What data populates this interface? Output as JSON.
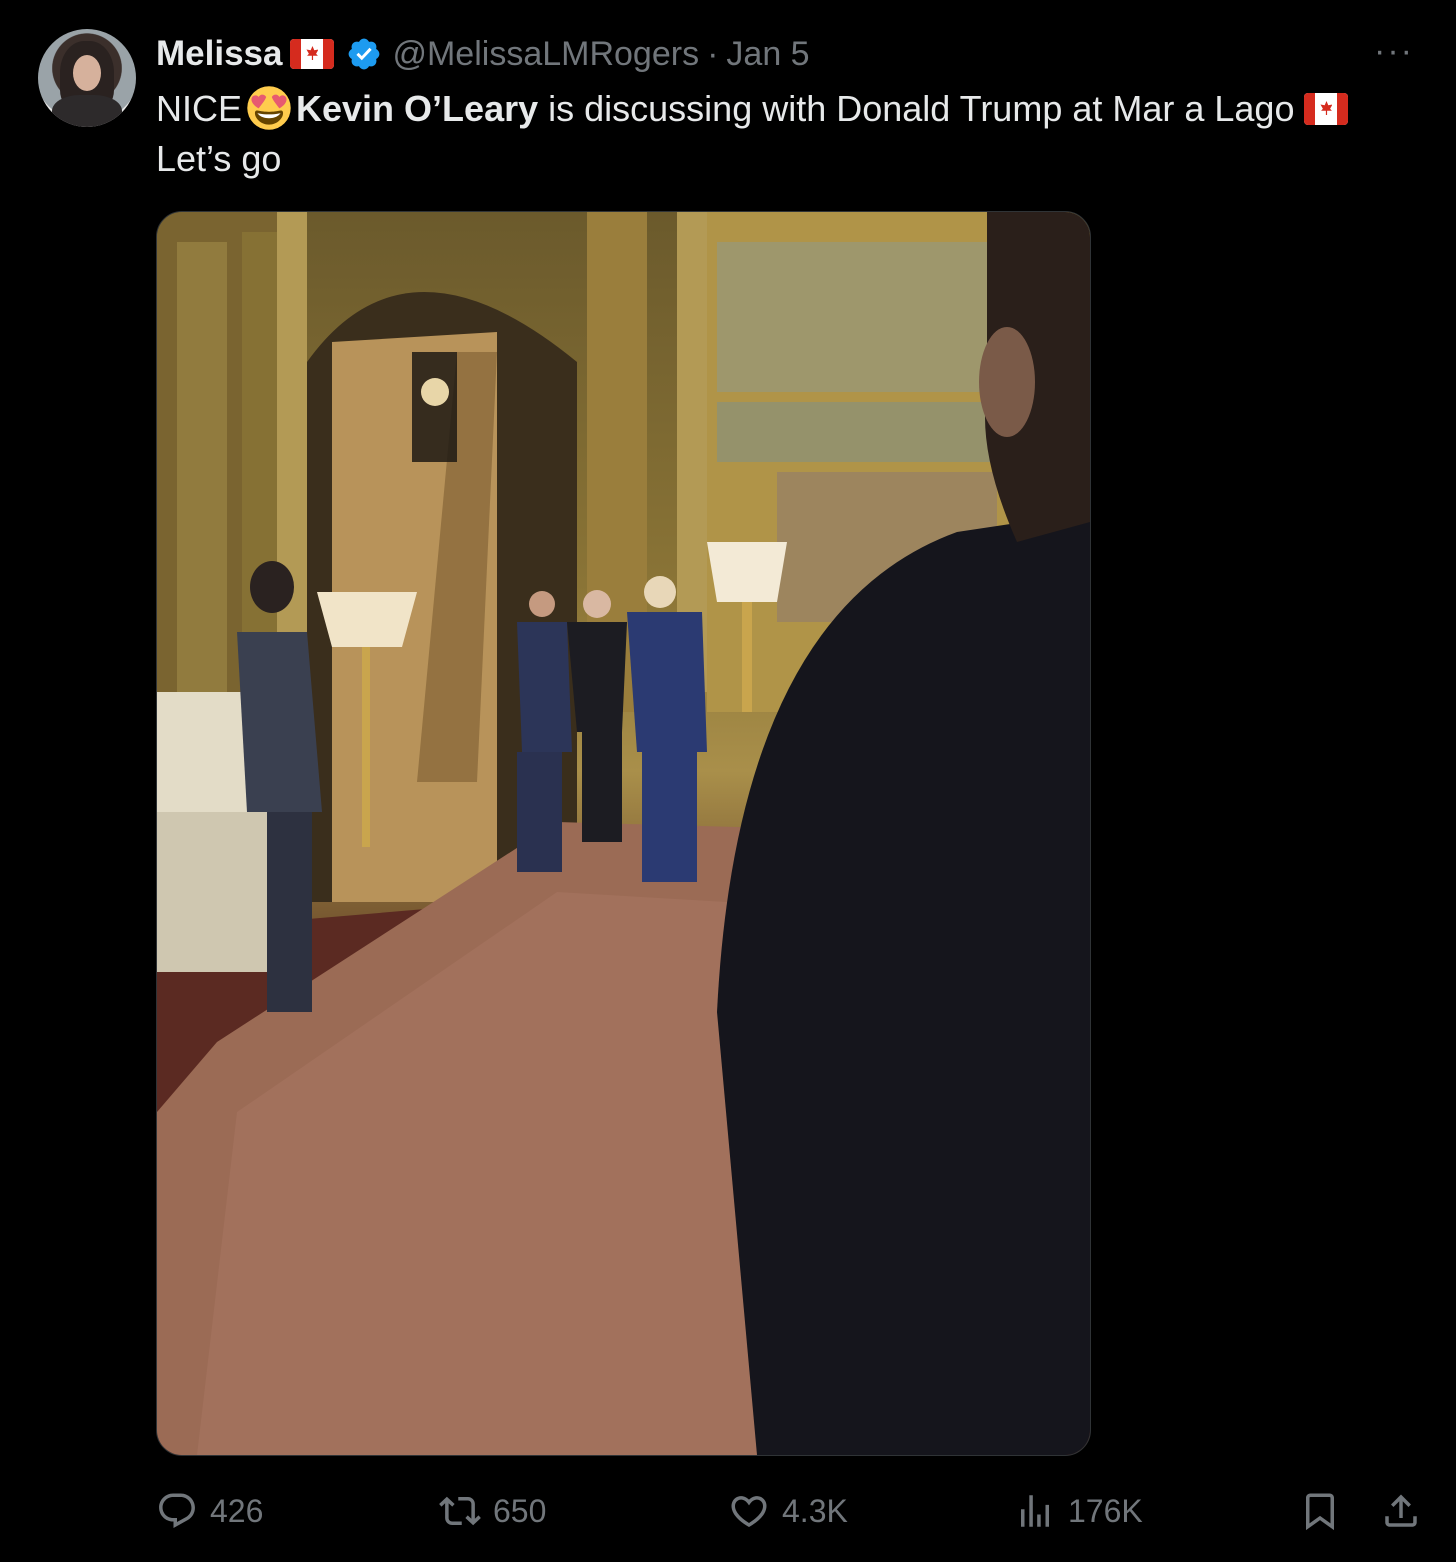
{
  "author": {
    "name": "Melissa",
    "handle": "@MelissaLMRogers",
    "separator": "·",
    "date": "Jan 5"
  },
  "more_label": "···",
  "tweet": {
    "part1": "NICE",
    "bold": "Kevin O’Leary",
    "part2": " is discussing with Donald Trump at Mar a Lago",
    "line2": "Let’s go"
  },
  "media": {
    "icon": "photo"
  },
  "actions": {
    "replies": "426",
    "reposts": "650",
    "likes": "4.3K",
    "views": "176K"
  },
  "colors": {
    "background": "#000000",
    "text": "#e7e9ea",
    "muted": "#71767b",
    "verified": "#1d9bf0",
    "flag_red": "#d52b1e"
  }
}
